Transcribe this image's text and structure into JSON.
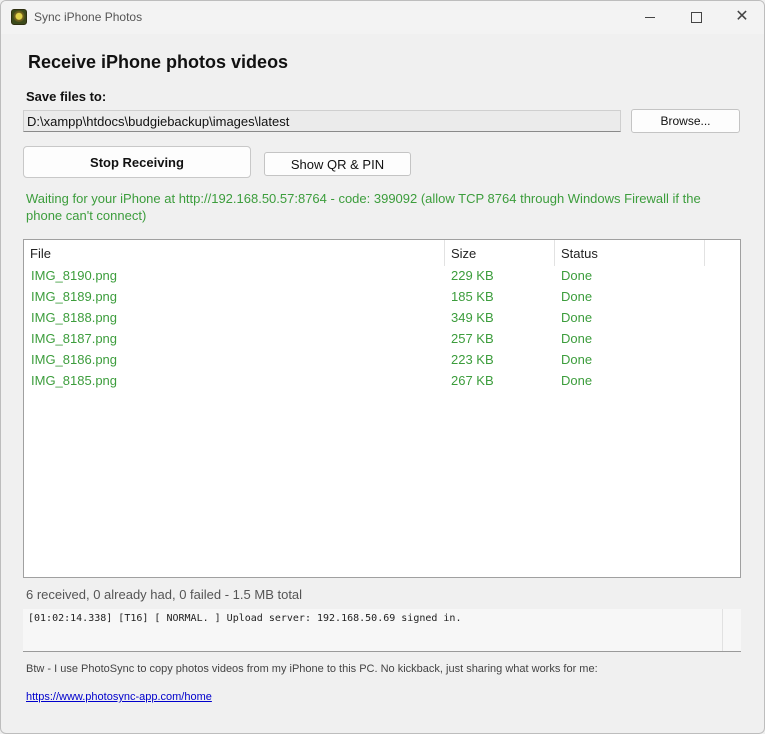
{
  "window": {
    "title": "Sync iPhone Photos"
  },
  "heading": "Receive iPhone photos  videos",
  "save_files": {
    "label": "Save files to:",
    "path": "D:\\xampp\\htdocs\\budgiebackup\\images\\latest",
    "browse_label": "Browse..."
  },
  "actions": {
    "stop_label": "Stop Receiving",
    "qr_label": "Show QR & PIN"
  },
  "status_message": "Waiting for your iPhone at http://192.168.50.57:8764  -  code: 399092  (allow TCP 8764 through Windows Firewall if the phone can't connect)",
  "table": {
    "columns": [
      "File",
      "Size",
      "Status"
    ],
    "rows": [
      {
        "file": "IMG_8190.png",
        "size": "229 KB",
        "status": "Done"
      },
      {
        "file": "IMG_8189.png",
        "size": "185 KB",
        "status": "Done"
      },
      {
        "file": "IMG_8188.png",
        "size": "349 KB",
        "status": "Done"
      },
      {
        "file": "IMG_8187.png",
        "size": "257 KB",
        "status": "Done"
      },
      {
        "file": "IMG_8186.png",
        "size": "223 KB",
        "status": "Done"
      },
      {
        "file": "IMG_8185.png",
        "size": "267 KB",
        "status": "Done"
      }
    ]
  },
  "summary": "6 received, 0 already had, 0 failed - 1.5 MB total",
  "log": "[01:02:14.338] [T16] [ NORMAL. ] Upload server: 192.168.50.69 signed in.",
  "footer": {
    "note": "Btw - I use PhotoSync to copy photos  videos from my iPhone to this PC. No kickback, just sharing what works for me:",
    "link": "https://www.photosync-app.com/home"
  },
  "colors": {
    "accent_green": "#3c9d3c",
    "link_blue": "#0000cc"
  },
  "icons": [
    "app-icon",
    "minimize-icon",
    "maximize-icon",
    "close-icon"
  ]
}
